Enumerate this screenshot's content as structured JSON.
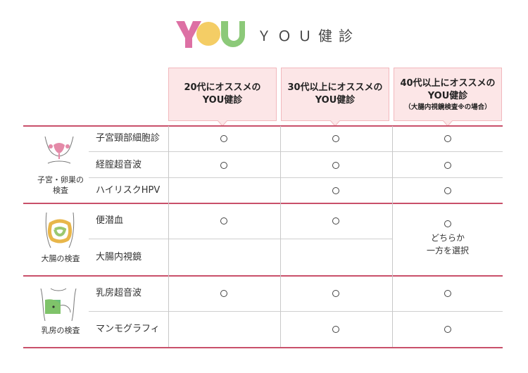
{
  "brand": {
    "logo_letters": "YOU",
    "title": "ＹＯＵ健診"
  },
  "columns": [
    {
      "line1": "20代にオススメの",
      "line2": "YOU健診",
      "sub": ""
    },
    {
      "line1": "30代以上にオススメの",
      "line2": "YOU健診",
      "sub": ""
    },
    {
      "line1": "40代以上にオススメの",
      "line2": "YOU健診",
      "sub": "（大腸内視鏡検査※の場合）"
    }
  ],
  "categories": [
    {
      "label_line1": "子宮・卵巣の",
      "label_line2": "検査",
      "icon": "uterus-icon"
    },
    {
      "label_line1": "大腸の検査",
      "label_line2": "",
      "icon": "intestine-icon"
    },
    {
      "label_line1": "乳房の検査",
      "label_line2": "",
      "icon": "breast-icon"
    }
  ],
  "rows": [
    {
      "name": "子宮頸部細胞診",
      "marks": [
        "○",
        "○",
        "○"
      ]
    },
    {
      "name": "経腟超音波",
      "marks": [
        "○",
        "○",
        "○"
      ]
    },
    {
      "name": "ハイリスクHPV",
      "marks": [
        "",
        "○",
        "○"
      ]
    },
    {
      "name": "便潜血",
      "marks": [
        "○",
        "○",
        "○"
      ]
    },
    {
      "name": "大腸内視鏡",
      "marks": [
        "",
        "",
        ""
      ]
    },
    {
      "name": "乳房超音波",
      "marks": [
        "○",
        "○",
        "○"
      ]
    },
    {
      "name": "マンモグラフィ",
      "marks": [
        "",
        "○",
        "○"
      ]
    }
  ],
  "either_note": {
    "line1": "どちらか",
    "line2": "一方を選択"
  },
  "colors": {
    "accent": "#c9506a",
    "header_bg": "#fce6e7",
    "header_border": "#f2b8bd"
  }
}
